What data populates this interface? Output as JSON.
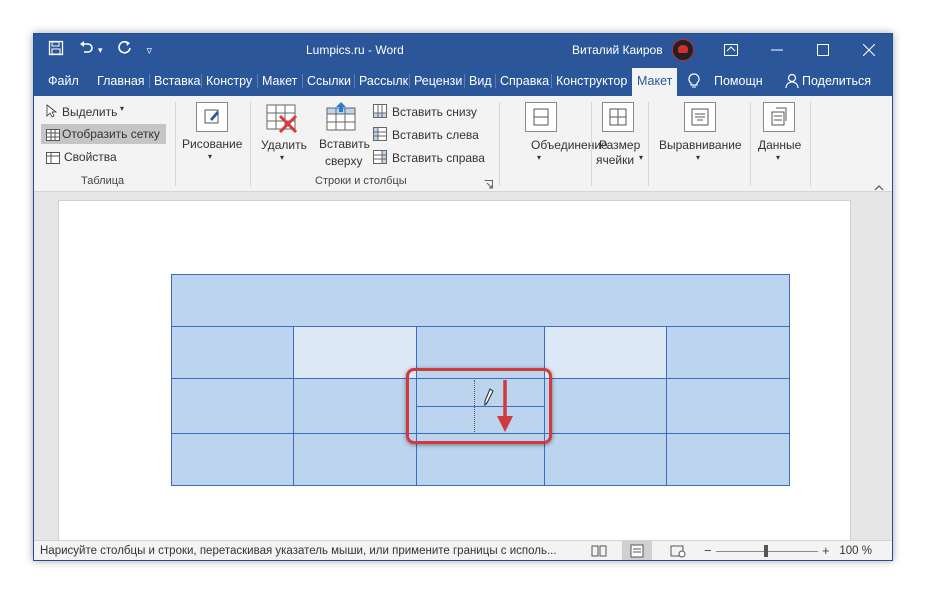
{
  "window": {
    "title": "Lumpics.ru  -  Word",
    "user": "Виталий Каиров"
  },
  "tabs": [
    "Файл",
    "Главная",
    "Вставка",
    "Констру",
    "Макет",
    "Ссылки",
    "Рассылк",
    "Рецензи",
    "Вид",
    "Справка",
    "Конструктор",
    "Макет"
  ],
  "tabs_right": {
    "help": "Помощн",
    "share": "Поделиться"
  },
  "ribbon": {
    "select": "Выделить",
    "show_grid": "Отобразить сетку",
    "properties": "Свойства",
    "group_table": "Таблица",
    "draw": "Рисование",
    "delete": "Удалить",
    "insert_above_1": "Вставить",
    "insert_above_2": "сверху",
    "insert_below": "Вставить снизу",
    "insert_left": "Вставить слева",
    "insert_right": "Вставить справа",
    "group_rows_cols": "Строки и столбцы",
    "merge": "Объединение",
    "cell_size_1": "Размер",
    "cell_size_2": "ячейки",
    "alignment": "Выравнивание",
    "data": "Данные"
  },
  "status": {
    "text": "Нарисуйте столбцы и строки, перетаскивая указатель мыши, или примените границы с исполь...",
    "zoom": "100 %"
  },
  "colors": {
    "accent": "#2b579a",
    "cell": "#bdd4ee",
    "cell_light": "#dde8f6",
    "border": "#3b6cc4",
    "highlight": "#d03a3a"
  }
}
